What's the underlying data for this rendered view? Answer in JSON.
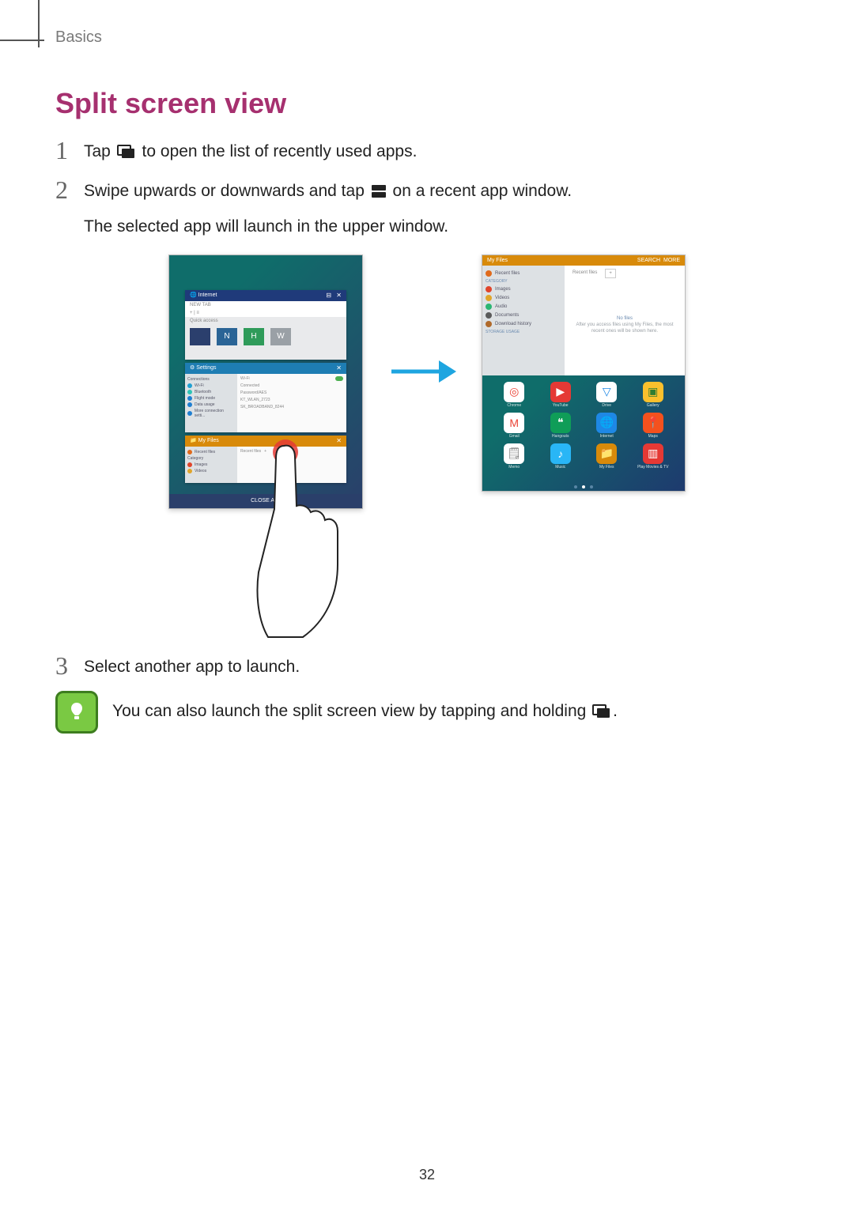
{
  "breadcrumb": "Basics",
  "page_title": "Split screen view",
  "page_number": "32",
  "steps": {
    "s1_pre": "Tap ",
    "s1_post": " to open the list of recently used apps.",
    "s2_pre": "Swipe upwards or downwards and tap ",
    "s2_post": " on a recent app window.",
    "s2_line2": "The selected app will launch in the upper window.",
    "s3": "Select another app to launch."
  },
  "note": {
    "text_pre": "You can also launch the split screen view by tapping and holding ",
    "text_post": "."
  },
  "fig_left": {
    "card_internet": {
      "title": "Internet",
      "tab": "NEW TAB",
      "address_hint": "+  |  ≡",
      "quick_access": "Quick access"
    },
    "card_settings": {
      "title": "Settings",
      "side": {
        "connections": "Connections",
        "wifi": "Wi-Fi",
        "bluetooth": "Bluetooth",
        "flight": "Flight mode",
        "data": "Data usage",
        "more": "More connection setti..."
      },
      "main": {
        "row_wifi": "Wi-Fi",
        "row_conn": "Connected",
        "row_pw": "Password/AES",
        "row_r1": "KT_WLAN_2723",
        "row_r2": "SK_BROADBAND_8244"
      }
    },
    "card_myfiles": {
      "title": "My Files",
      "side": {
        "recent": "Recent files",
        "category": "Category",
        "images": "Images",
        "videos": "Videos"
      },
      "main_tab": "Recent files",
      "main_plus": "+"
    },
    "close_all": "CLOSE ALL"
  },
  "fig_right": {
    "titlebar": {
      "title": "My Files",
      "r1": "SEARCH",
      "r2": "MORE"
    },
    "side": {
      "recent": "Recent files",
      "category_label": "Category",
      "images": "Images",
      "videos": "Videos",
      "audio": "Audio",
      "documents": "Documents",
      "download": "Download history",
      "storage_label": "STORAGE USAGE"
    },
    "main": {
      "tab1": "Recent files",
      "tab2": "+",
      "empty_title": "No files",
      "empty_sub1": "After you access files using My Files, the most",
      "empty_sub2": "recent ones will be shown here."
    },
    "apps": {
      "a1": "Chrome",
      "a2": "YouTube",
      "a3": "Drive",
      "a4": "Gallery",
      "a5": "Gmail",
      "a6": "Hangouts",
      "a7": "Internet",
      "a8": "Maps",
      "a9": "Memo",
      "a10": "Music",
      "a11": "My Files",
      "a12": "Play Movies & TV"
    }
  }
}
